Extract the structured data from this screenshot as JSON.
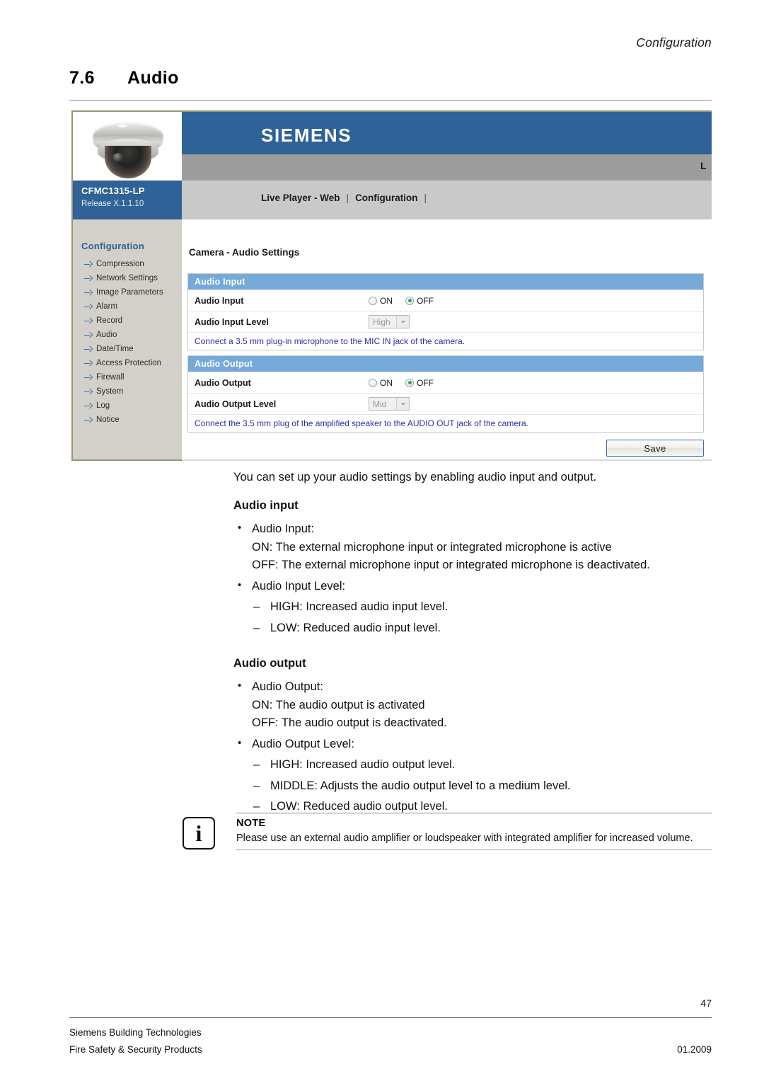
{
  "header": {
    "running_title": "Configuration"
  },
  "chapter": {
    "number": "7.6",
    "title": "Audio"
  },
  "screenshot": {
    "brand": "SIEMENS",
    "topbar_right_clipped": "L",
    "device": {
      "model": "CFMC1315-LP",
      "release": "Release X.1.1.10"
    },
    "nav": {
      "item1": "Live Player - Web",
      "sep1": "|",
      "item2": "Configuration",
      "sep2": "|"
    },
    "sidebar": {
      "heading": "Configuration",
      "items": [
        {
          "label": "Compression"
        },
        {
          "label": "Network Settings"
        },
        {
          "label": "Image Parameters"
        },
        {
          "label": "Alarm"
        },
        {
          "label": "Record"
        },
        {
          "label": "Audio"
        },
        {
          "label": "Date/Time"
        },
        {
          "label": "Access Protection"
        },
        {
          "label": "Firewall"
        },
        {
          "label": "System"
        },
        {
          "label": "Log"
        },
        {
          "label": "Notice"
        }
      ]
    },
    "content_title": "Camera - Audio Settings",
    "audio_input": {
      "panel_title": "Audio Input",
      "row1_label": "Audio Input",
      "option_on": "ON",
      "option_off": "OFF",
      "selected": "OFF",
      "row2_label": "Audio Input Level",
      "level_value": "High",
      "hint": "Connect a 3.5 mm plug-in microphone to the MIC IN jack of the camera."
    },
    "audio_output": {
      "panel_title": "Audio Output",
      "row1_label": "Audio Output",
      "option_on": "ON",
      "option_off": "OFF",
      "selected": "OFF",
      "row2_label": "Audio Output Level",
      "level_value": "Mid",
      "hint": "Connect the 3.5 mm plug of the amplified speaker to the AUDIO OUT jack of the camera."
    },
    "save_label": "Save"
  },
  "body": {
    "intro": "You can set up your audio settings by enabling audio input and output.",
    "input_heading": "Audio input",
    "input_b1": "Audio Input:",
    "input_b1_on": "ON: The external microphone input or integrated microphone is active",
    "input_b1_off": "OFF: The external microphone input or integrated microphone is deactivated.",
    "input_b2": "Audio Input Level:",
    "input_b2_high": "HIGH: Increased audio input level.",
    "input_b2_low": "LOW: Reduced audio input level.",
    "output_heading": "Audio output",
    "output_b1": "Audio Output:",
    "output_b1_on": "ON: The audio output is activated",
    "output_b1_off": "OFF: The audio output is deactivated.",
    "output_b2": "Audio Output Level:",
    "output_b2_high": "HIGH: Increased audio output level.",
    "output_b2_mid": "MIDDLE: Adjusts the audio output level to a medium level.",
    "output_b2_low": "LOW: Reduced audio output level."
  },
  "note": {
    "icon_glyph": "i",
    "title": "NOTE",
    "text": "Please use an external audio amplifier or loudspeaker with integrated amplifier for increased volume."
  },
  "footer": {
    "page_number": "47",
    "company": "Siemens Building Technologies",
    "division": "Fire Safety & Security Products",
    "date": "01.2009"
  }
}
